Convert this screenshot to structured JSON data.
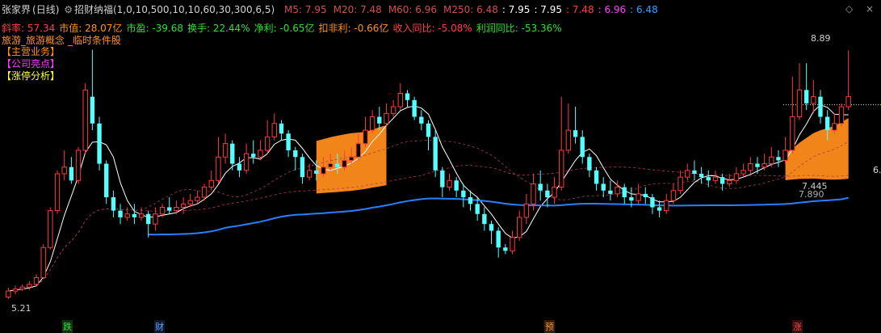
{
  "header": {
    "stock_name": "张家界",
    "period": "(日线)",
    "indicator_name": "招财纳福(1,0,10,500,10,10,60,30,300,6,5)",
    "ma": [
      {
        "label": "M5:",
        "value": "7.95",
        "color": "#d05050"
      },
      {
        "label": "M20:",
        "value": "7.48",
        "color": "#d05050"
      },
      {
        "label": "M60:",
        "value": "6.96",
        "color": "#d05050"
      },
      {
        "label": "M250:",
        "value": "6.48",
        "color": "#d05050"
      }
    ],
    "extra_values": [
      {
        "text": ": 7.95",
        "color": "#ffffff"
      },
      {
        "text": ": 7.95",
        "color": "#ffffff"
      },
      {
        "text": ": 7.48",
        "color": "#ff4040"
      },
      {
        "text": ": 6.96",
        "color": "#ff40ff"
      },
      {
        "text": ": 6.48",
        "color": "#3aa0ff"
      }
    ]
  },
  "info_row1": [
    {
      "text": "斜率: 57.34",
      "color": "#ff4040"
    },
    {
      "text": "市值: 28.07亿",
      "color": "#ff9020"
    },
    {
      "text": "市盈: -39.68",
      "color": "#30e030"
    },
    {
      "text": "换手: 22.44%",
      "color": "#30e030"
    },
    {
      "text": "净利: -0.65亿",
      "color": "#30e030"
    },
    {
      "text": "扣非利: -0.66亿",
      "color": "#ff9020"
    },
    {
      "text": "收入同比: -5.08%",
      "color": "#ff4040"
    },
    {
      "text": "利润同比: -53.36%",
      "color": "#30e030"
    }
  ],
  "info_row2": {
    "text": "旅游_旅游概念 _临时条件股",
    "color": "#ff9020"
  },
  "tags": [
    {
      "label": "【主营业务】",
      "color": "#ff9020"
    },
    {
      "label": "【公司亮点】",
      "color": "#ff40ff"
    },
    {
      "label": "【涨停分析】",
      "color": "#ffff40"
    }
  ],
  "price_labels": {
    "high": "8.89",
    "low": "5.21",
    "mid1": "7.445",
    "mid2": "7.890",
    "right_axis": "6."
  },
  "bottom_marks": [
    {
      "text": "跌",
      "color": "#30e030",
      "bg": "#103010"
    },
    {
      "text": "财",
      "color": "#60a0ff",
      "bg": "#101830"
    },
    {
      "text": "预",
      "color": "#ff9020",
      "bg": "#302010"
    },
    {
      "text": "涨",
      "color": "#ff4040",
      "bg": "#301010"
    }
  ],
  "chart_data": {
    "type": "candlestick",
    "ylim": [
      5.0,
      9.1
    ],
    "candles": [
      [
        5.21,
        5.3,
        5.35,
        5.18
      ],
      [
        5.3,
        5.33,
        5.38,
        5.25
      ],
      [
        5.33,
        5.36,
        5.4,
        5.3
      ],
      [
        5.36,
        5.4,
        5.45,
        5.32
      ],
      [
        5.4,
        5.5,
        5.55,
        5.38
      ],
      [
        5.5,
        5.95,
        6.0,
        5.48
      ],
      [
        5.95,
        6.5,
        6.55,
        5.92
      ],
      [
        6.5,
        7.05,
        7.1,
        6.45
      ],
      [
        7.05,
        7.15,
        7.4,
        6.95
      ],
      [
        7.15,
        6.95,
        7.3,
        6.9
      ],
      [
        6.95,
        7.4,
        7.45,
        6.9
      ],
      [
        7.4,
        8.3,
        8.4,
        7.35
      ],
      [
        8.2,
        7.8,
        8.9,
        7.7
      ],
      [
        7.8,
        7.2,
        7.9,
        7.1
      ],
      [
        7.2,
        6.7,
        7.25,
        6.6
      ],
      [
        6.7,
        6.5,
        6.8,
        6.4
      ],
      [
        6.5,
        6.4,
        6.6,
        6.3
      ],
      [
        6.4,
        6.45,
        6.55,
        6.35
      ],
      [
        6.45,
        6.4,
        6.6,
        6.3
      ],
      [
        6.4,
        6.45,
        6.55,
        6.35
      ],
      [
        6.45,
        6.3,
        6.5,
        6.1
      ],
      [
        6.3,
        6.45,
        6.55,
        6.2
      ],
      [
        6.45,
        6.55,
        6.6,
        6.4
      ],
      [
        6.55,
        6.5,
        6.7,
        6.45
      ],
      [
        6.5,
        6.55,
        6.65,
        6.45
      ],
      [
        6.55,
        6.6,
        6.7,
        6.45
      ],
      [
        6.6,
        6.65,
        6.75,
        6.55
      ],
      [
        6.65,
        6.7,
        6.8,
        6.6
      ],
      [
        6.7,
        6.85,
        6.9,
        6.65
      ],
      [
        6.85,
        6.95,
        7.1,
        6.8
      ],
      [
        6.95,
        7.3,
        7.6,
        6.9
      ],
      [
        7.3,
        7.5,
        7.65,
        7.2
      ],
      [
        7.5,
        7.2,
        7.55,
        7.1
      ],
      [
        7.2,
        7.1,
        7.3,
        7.0
      ],
      [
        7.1,
        7.35,
        7.5,
        7.05
      ],
      [
        7.35,
        7.3,
        7.55,
        7.2
      ],
      [
        7.3,
        7.4,
        7.55,
        7.25
      ],
      [
        7.4,
        7.6,
        7.85,
        7.35
      ],
      [
        7.6,
        7.8,
        7.95,
        7.55
      ],
      [
        7.8,
        7.65,
        7.85,
        7.55
      ],
      [
        7.65,
        7.4,
        7.7,
        7.3
      ],
      [
        7.4,
        7.3,
        7.45,
        7.1
      ],
      [
        7.3,
        7.0,
        7.35,
        6.9
      ],
      [
        7.0,
        7.1,
        7.2,
        6.95
      ],
      [
        7.1,
        7.05,
        7.25,
        6.95
      ],
      [
        7.05,
        7.15,
        7.3,
        7.0
      ],
      [
        7.15,
        7.2,
        7.35,
        7.1
      ],
      [
        7.2,
        7.15,
        7.35,
        7.05
      ],
      [
        7.15,
        7.25,
        7.4,
        7.1
      ],
      [
        7.25,
        7.3,
        7.45,
        7.2
      ],
      [
        7.3,
        7.5,
        7.65,
        7.25
      ],
      [
        7.5,
        7.7,
        7.9,
        7.45
      ],
      [
        7.7,
        7.9,
        8.0,
        7.65
      ],
      [
        7.9,
        7.8,
        8.05,
        7.7
      ],
      [
        7.8,
        7.95,
        8.1,
        7.75
      ],
      [
        7.95,
        8.05,
        8.15,
        7.9
      ],
      [
        8.05,
        8.25,
        8.4,
        8.0
      ],
      [
        8.25,
        8.15,
        8.3,
        8.05
      ],
      [
        8.15,
        7.9,
        8.2,
        7.85
      ],
      [
        7.9,
        7.8,
        8.0,
        7.7
      ],
      [
        7.8,
        7.6,
        7.85,
        7.4
      ],
      [
        7.6,
        7.1,
        7.7,
        7.0
      ],
      [
        7.1,
        6.85,
        7.15,
        6.7
      ],
      [
        6.85,
        6.95,
        7.05,
        6.8
      ],
      [
        6.95,
        6.8,
        7.0,
        6.7
      ],
      [
        6.8,
        6.7,
        6.9,
        6.55
      ],
      [
        6.7,
        6.6,
        6.8,
        6.5
      ],
      [
        6.6,
        6.45,
        6.7,
        6.35
      ],
      [
        6.45,
        6.3,
        6.55,
        6.2
      ],
      [
        6.3,
        6.2,
        6.35,
        6.0
      ],
      [
        6.2,
        5.95,
        6.25,
        5.8
      ],
      [
        5.95,
        5.9,
        6.0,
        5.85
      ],
      [
        5.9,
        6.1,
        6.2,
        5.85
      ],
      [
        6.1,
        6.4,
        6.5,
        6.05
      ],
      [
        6.4,
        6.6,
        6.75,
        6.3
      ],
      [
        6.6,
        6.9,
        7.05,
        6.5
      ],
      [
        6.9,
        6.8,
        7.1,
        6.65
      ],
      [
        6.8,
        6.7,
        6.9,
        6.55
      ],
      [
        6.7,
        6.85,
        7.0,
        6.6
      ],
      [
        6.85,
        7.4,
        8.2,
        6.8
      ],
      [
        7.4,
        7.7,
        8.1,
        7.35
      ],
      [
        7.7,
        7.6,
        8.05,
        7.5
      ],
      [
        7.6,
        7.3,
        7.7,
        7.2
      ],
      [
        7.3,
        7.1,
        7.35,
        7.0
      ],
      [
        7.1,
        6.9,
        7.15,
        6.8
      ],
      [
        6.9,
        6.8,
        7.0,
        6.7
      ],
      [
        6.8,
        6.75,
        6.95,
        6.65
      ],
      [
        6.75,
        6.85,
        6.95,
        6.7
      ],
      [
        6.85,
        6.7,
        6.9,
        6.6
      ],
      [
        6.7,
        6.65,
        6.85,
        6.55
      ],
      [
        6.65,
        6.75,
        6.9,
        6.6
      ],
      [
        6.75,
        6.7,
        6.85,
        6.6
      ],
      [
        6.7,
        6.55,
        6.75,
        6.45
      ],
      [
        6.55,
        6.5,
        6.65,
        6.4
      ],
      [
        6.5,
        6.65,
        6.75,
        6.45
      ],
      [
        6.65,
        6.8,
        6.9,
        6.6
      ],
      [
        6.8,
        7.0,
        7.1,
        6.75
      ],
      [
        7.0,
        7.1,
        7.2,
        6.95
      ],
      [
        7.1,
        7.05,
        7.25,
        6.95
      ],
      [
        7.05,
        7.0,
        7.15,
        6.9
      ],
      [
        7.0,
        6.95,
        7.1,
        6.85
      ],
      [
        6.95,
        7.0,
        7.1,
        6.9
      ],
      [
        7.0,
        6.9,
        7.05,
        6.8
      ],
      [
        6.9,
        6.95,
        7.05,
        6.85
      ],
      [
        6.95,
        7.05,
        7.15,
        6.9
      ],
      [
        7.05,
        7.1,
        7.2,
        7.0
      ],
      [
        7.1,
        7.2,
        7.3,
        7.05
      ],
      [
        7.2,
        7.15,
        7.3,
        7.05
      ],
      [
        7.15,
        7.2,
        7.35,
        7.1
      ],
      [
        7.2,
        7.3,
        7.45,
        7.15
      ],
      [
        7.3,
        7.25,
        7.4,
        7.15
      ],
      [
        7.25,
        7.4,
        7.6,
        7.2
      ],
      [
        7.4,
        7.9,
        8.5,
        7.35
      ],
      [
        7.9,
        8.3,
        8.7,
        7.85
      ],
      [
        8.3,
        8.1,
        8.7,
        8.0
      ],
      [
        8.1,
        8.2,
        8.45,
        7.95
      ],
      [
        8.2,
        7.9,
        8.3,
        7.8
      ],
      [
        7.9,
        7.7,
        8.0,
        7.55
      ],
      [
        7.7,
        7.8,
        7.95,
        7.65
      ],
      [
        7.8,
        8.05,
        8.1,
        7.75
      ],
      [
        8.05,
        8.2,
        8.89,
        8.0
      ]
    ]
  }
}
